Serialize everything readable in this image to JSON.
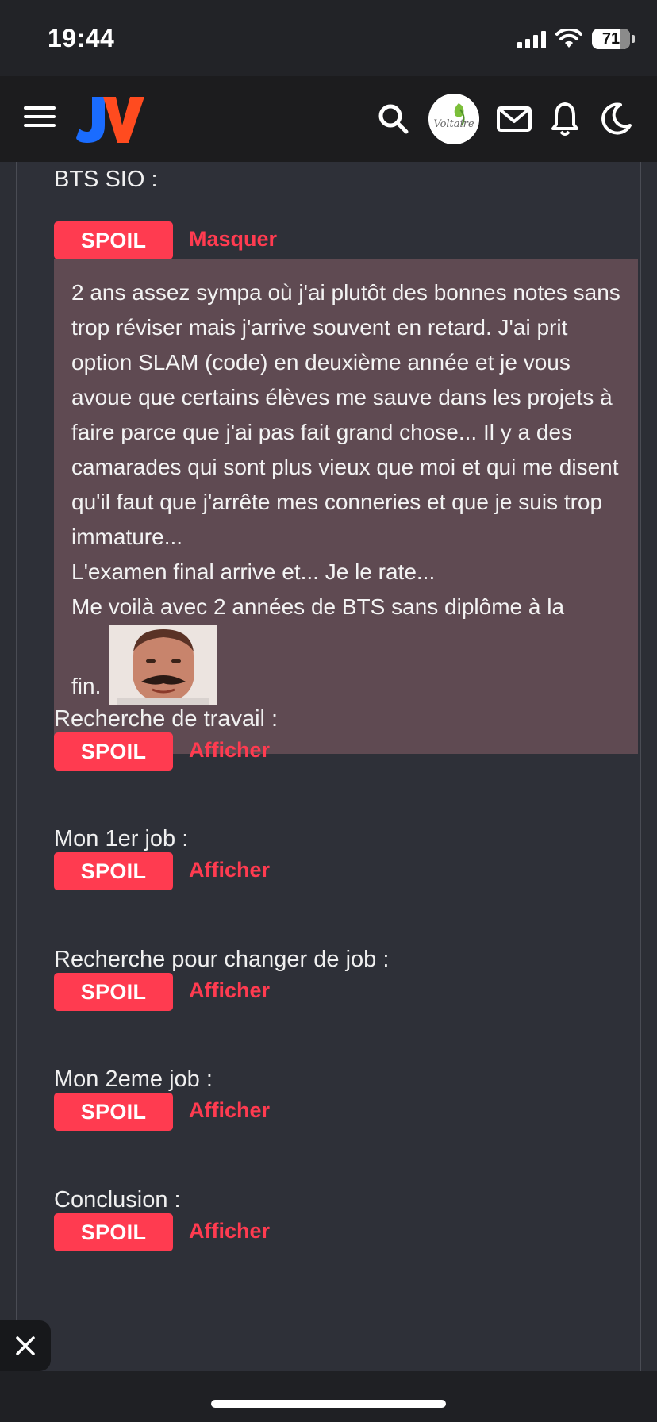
{
  "status_bar": {
    "time": "19:44",
    "battery_percent": "71",
    "signal_bars": 4,
    "icons": [
      "signal-icon",
      "wifi-icon",
      "battery-icon"
    ]
  },
  "header": {
    "logo_text": "JV",
    "avatar_text": "Voltaire",
    "icons": [
      "menu-icon",
      "search-icon",
      "mail-icon",
      "bell-icon",
      "moon-icon"
    ]
  },
  "content": {
    "top_label": "BTS SIO :",
    "spoil_label": "SPOIL",
    "hide_label": "Masquer",
    "show_label": "Afficher",
    "open_spoiler": {
      "paragraphs": [
        "2 ans assez sympa où j'ai plutôt des bonnes notes sans trop réviser mais j'arrive souvent en retard. J'ai prit option SLAM (code) en deuxième année et je vous avoue que certains élèves me sauve dans les projets à faire parce que j'ai pas fait grand chose... Il y a des camarades qui sont plus vieux que moi et qui me disent qu'il faut que j'arrête mes conneries et que je suis trop immature...",
        "L'examen final arrive et... Je le rate...",
        "Me voilà avec 2 années de BTS sans diplôme à la"
      ],
      "last_word": "fin."
    },
    "sections": [
      {
        "label": "Recherche de travail :"
      },
      {
        "label": "Mon 1er job :"
      },
      {
        "label": "Recherche pour changer de job :"
      },
      {
        "label": "Mon 2eme job :"
      },
      {
        "label": "Conclusion :"
      }
    ]
  },
  "colors": {
    "accent": "#ff3b50",
    "background": "#2e3038",
    "spoiler_background": "#5f4a52",
    "header": "#1c1c1e"
  }
}
